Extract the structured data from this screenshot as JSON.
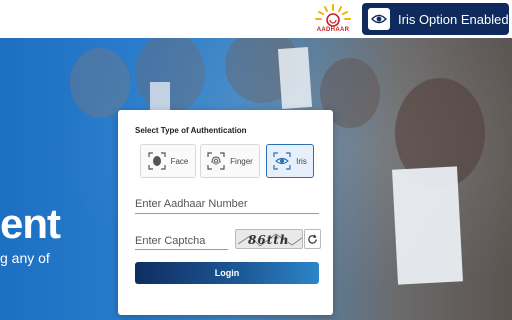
{
  "header": {
    "logo_text": "AADHAAR",
    "iris_status": "Iris Option Enabled"
  },
  "hero": {
    "title": "ent",
    "subtitle": "g any of"
  },
  "auth_card": {
    "title": "Select Type of Authentication",
    "options": [
      {
        "label": "Face",
        "icon": "face-scan-icon"
      },
      {
        "label": "Finger",
        "icon": "fingerprint-icon"
      },
      {
        "label": "Iris",
        "icon": "iris-icon"
      }
    ],
    "selected": "Iris",
    "aadhaar_placeholder": "Enter Aadhaar Number",
    "captcha_placeholder": "Enter Captcha",
    "captcha_text": "86tth",
    "login_label": "Login"
  },
  "colors": {
    "brand_navy": "#0f2a5c",
    "accent_blue": "#2a6fb3",
    "aadhaar_red": "#c8202a"
  }
}
